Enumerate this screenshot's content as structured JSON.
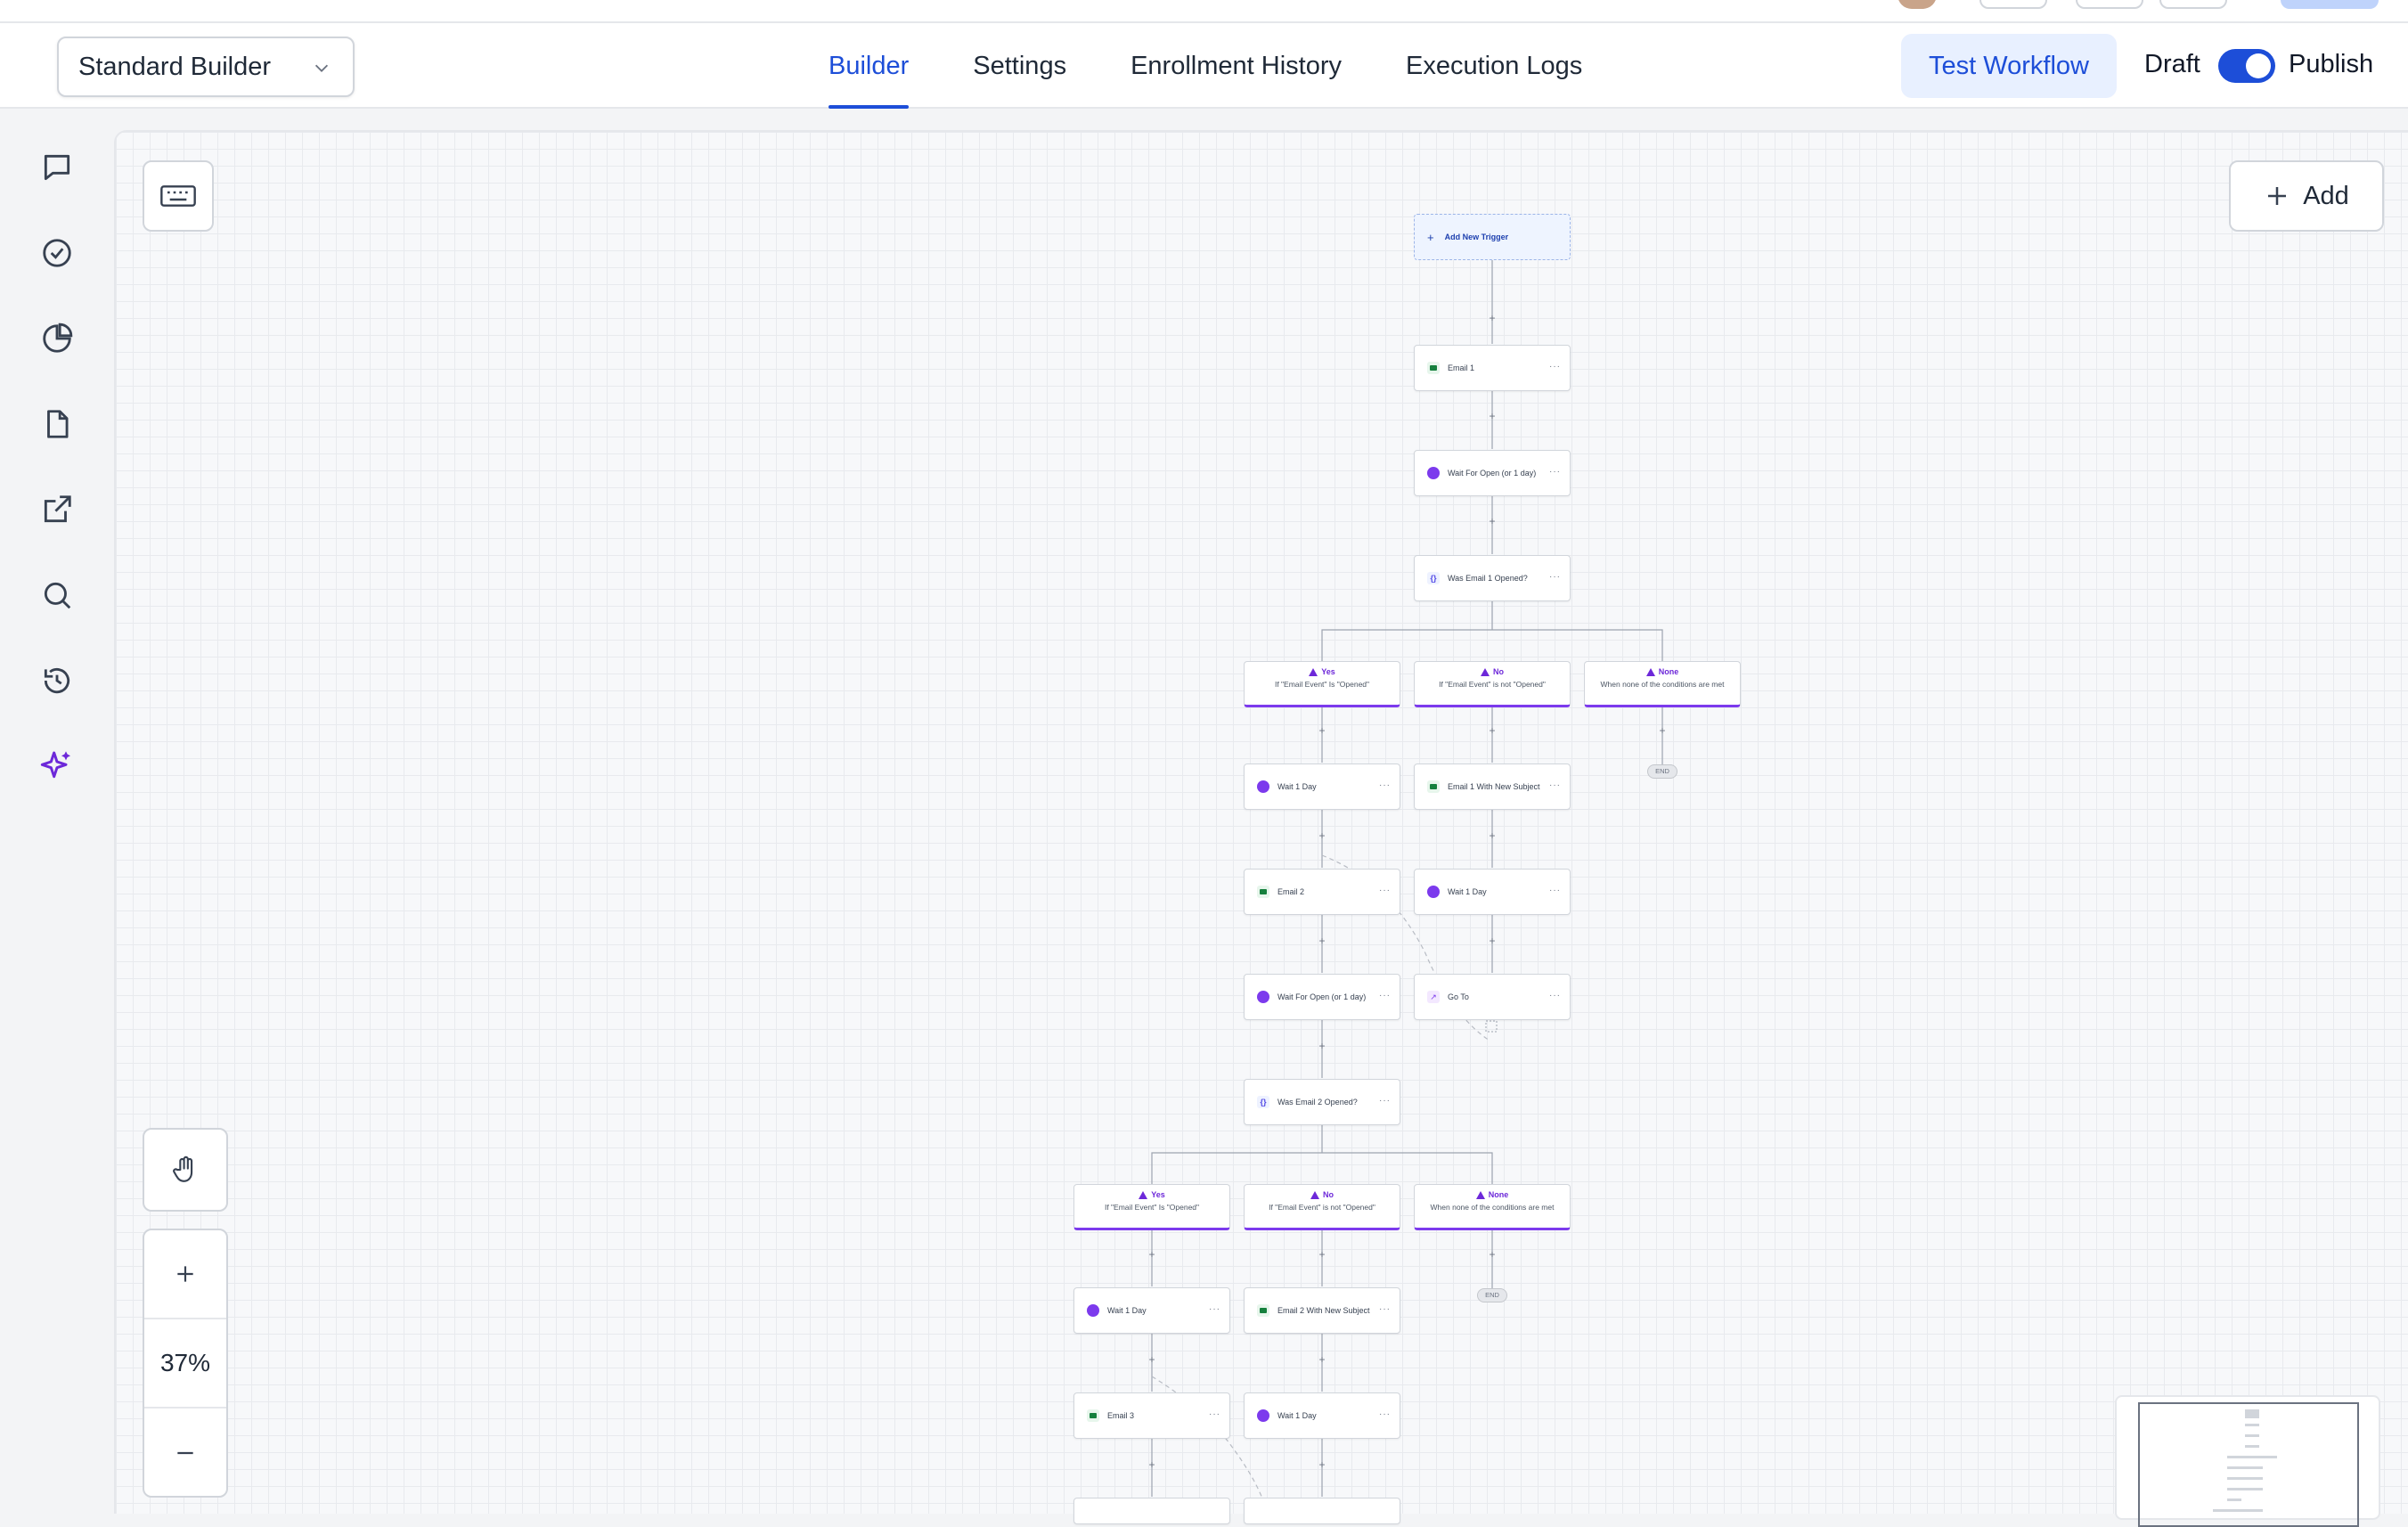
{
  "header": {
    "builder_select": "Standard Builder",
    "tabs": [
      {
        "label": "Builder",
        "active": true
      },
      {
        "label": "Settings",
        "active": false
      },
      {
        "label": "Enrollment History",
        "active": false
      },
      {
        "label": "Execution Logs",
        "active": false
      }
    ],
    "test_workflow": "Test Workflow",
    "draft_label": "Draft",
    "publish_label": "Publish",
    "published_toggle_on": true
  },
  "rail_icons": [
    "chat-icon",
    "check-circle-icon",
    "pie-chart-icon",
    "document-icon",
    "external-link-icon",
    "search-icon",
    "history-icon",
    "sparkles-icon"
  ],
  "canvas": {
    "add_label": "Add",
    "zoom_level": "37%",
    "zoom_in": "+",
    "zoom_out": "−"
  },
  "workflow": {
    "trigger": "Add New Trigger",
    "end_label": "END",
    "nodes": {
      "email1": "Email 1",
      "wait_open1": "Wait For Open (or 1 day)",
      "cond1": "Was Email 1 Opened?",
      "yes1_wait": "Wait 1 Day",
      "no1_email": "Email 1 With New Subject",
      "yes1_email2": "Email 2",
      "no1_wait": "Wait 1 Day",
      "yes1_wait_open2": "Wait For Open (or 1 day)",
      "no1_goto": "Go To",
      "cond2": "Was Email 2 Opened?",
      "yes2_wait": "Wait 1 Day",
      "no2_email": "Email 2 With New Subject",
      "yes2_email3": "Email 3",
      "no2_wait": "Wait 1 Day"
    },
    "branches": {
      "yes_title": "Yes",
      "yes_sub": "If \"Email Event\" Is \"Opened\"",
      "no_title": "No",
      "no_sub": "If \"Email Event\" is not \"Opened\"",
      "none_title": "None",
      "none_sub": "When none of the conditions are met"
    }
  }
}
